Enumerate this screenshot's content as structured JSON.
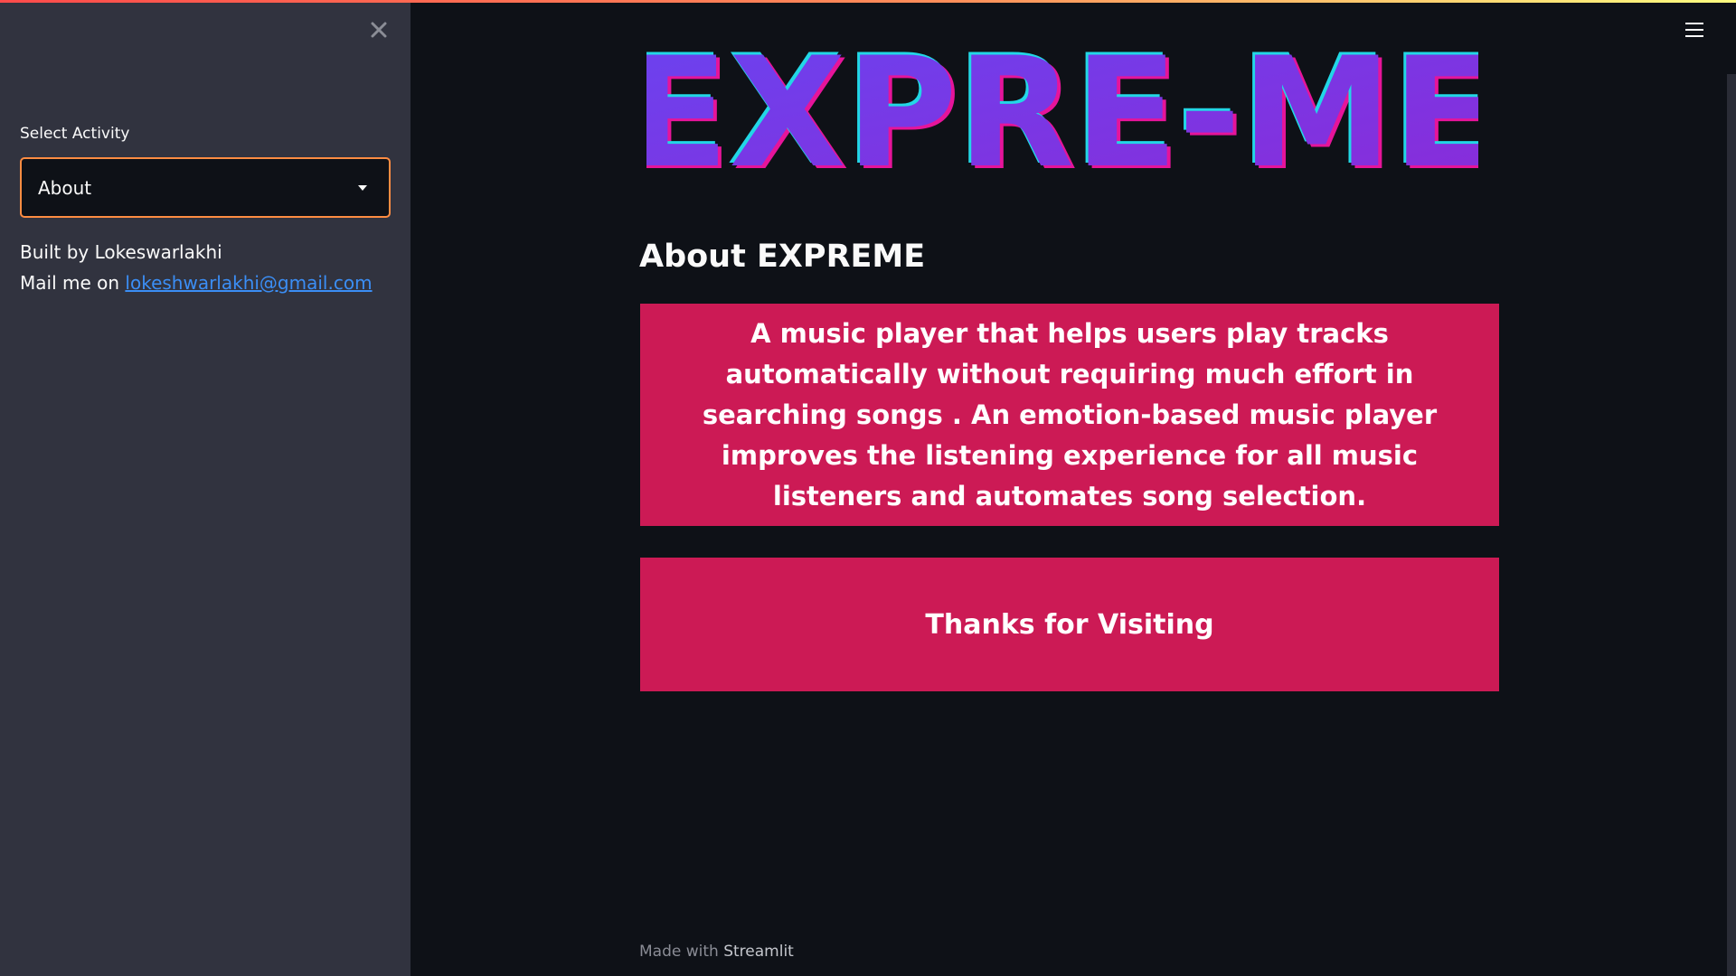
{
  "sidebar": {
    "select_label": "Select Activity",
    "selected_activity": "About",
    "built_by": "Built by Lokeswarlakhi",
    "mail_prefix": "Mail me on",
    "mail_link": "lokeshwarlakhi@gmail.com"
  },
  "main": {
    "logo_text": "EXPRE-ME",
    "heading": "About EXPREME",
    "about_text": "A music player that helps users play tracks automatically without requiring much effort in searching songs . An emotion-based music player improves the listening experience for all music listeners and automates song selection.",
    "thanks_text": "Thanks for Visiting"
  },
  "footer": {
    "made_with": "Made with",
    "brand": "Streamlit"
  },
  "icons": {
    "close": "close-icon",
    "menu": "hamburger-menu-icon",
    "dropdown": "caret-down-icon"
  },
  "colors": {
    "accent_border": "#ff8c42",
    "card_bg": "#cc1a55",
    "link": "#3b8ef5",
    "logo_fill": "#7b3fe4",
    "logo_cyan": "#22d7e6",
    "logo_magenta": "#e6149a"
  }
}
